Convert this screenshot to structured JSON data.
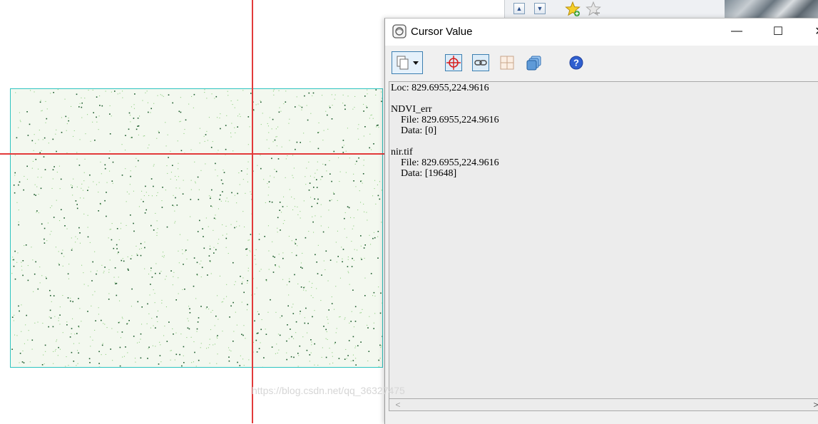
{
  "window": {
    "title": "Cursor Value"
  },
  "controls": {
    "minimize": "—",
    "maximize": "☐",
    "close": "✕"
  },
  "toolbar": {
    "tools": [
      {
        "name": "copy",
        "icon": "copy-icon"
      },
      {
        "name": "crosshair",
        "icon": "crosshair-icon"
      },
      {
        "name": "link",
        "icon": "link-icon"
      },
      {
        "name": "grid",
        "icon": "grid-icon"
      },
      {
        "name": "layers",
        "icon": "layers-icon"
      },
      {
        "name": "help",
        "icon": "help-icon"
      }
    ]
  },
  "cursor_value": {
    "loc": "Loc: 829.6955,224.9616",
    "layers": [
      {
        "name": "NDVI_err",
        "file": "File: 829.6955,224.9616",
        "data": "Data: [0]"
      },
      {
        "name": "nir.tif",
        "file": "File: 829.6955,224.9616",
        "data": "Data: [19648]"
      }
    ]
  },
  "scrollbar": {
    "left_arrow": "<",
    "right_arrow": ">"
  },
  "watermark": "https://blog.csdn.net/qq_36327475",
  "colors": {
    "crosshair": "#e23a3a",
    "raster_border": "#2ec4c0",
    "raster_bg": "#f3f8ef",
    "pixel_dark": "#1a5a2a",
    "pixel_light": "#8fcf80"
  }
}
